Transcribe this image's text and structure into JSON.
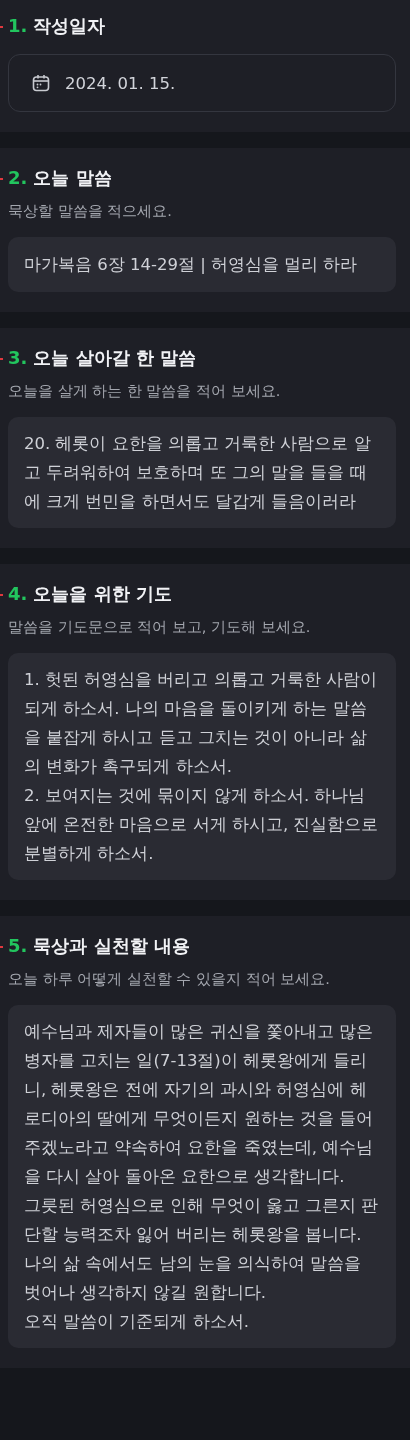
{
  "sections": [
    {
      "kind": "date",
      "required": true,
      "number": "1.",
      "title": "작성일자",
      "value": "2024. 01. 15."
    },
    {
      "kind": "text",
      "required": true,
      "number": "2.",
      "title": "오늘 말씀",
      "description": "묵상할 말씀을 적으세요.",
      "value": "마가복음 6장 14-29절  |  허영심을 멀리 하라"
    },
    {
      "kind": "text",
      "required": true,
      "number": "3.",
      "title": "오늘 살아갈 한 말씀",
      "description": "오늘을 살게 하는 한 말씀을 적어 보세요.",
      "value": "20. 헤롯이 요한을 의롭고 거룩한 사람으로 알고 두려워하여 보호하며 또 그의 말을 들을 때에 크게 번민을 하면서도 달갑게 들음이러라"
    },
    {
      "kind": "text",
      "required": true,
      "number": "4.",
      "title": "오늘을 위한 기도",
      "description": "말씀을 기도문으로 적어 보고, 기도해 보세요.",
      "value": "1. 헛된 허영심을 버리고 의롭고 거룩한 사람이 되게 하소서. 나의 마음을 돌이키게 하는 말씀을 붙잡게 하시고 듣고 그치는 것이 아니라 삶의 변화가 촉구되게 하소서.\n2. 보여지는 것에 묶이지 않게 하소서. 하나님 앞에 온전한 마음으로 서게 하시고, 진실함으로 분별하게 하소서."
    },
    {
      "kind": "text",
      "required": true,
      "number": "5.",
      "title": "묵상과 실천할 내용",
      "description": "오늘 하루 어떻게 실천할 수 있을지 적어 보세요.",
      "value": "예수님과 제자들이 많은 귀신을 쫓아내고 많은 병자를 고치는 일(7-13절)이 헤롯왕에게 들리니, 헤롯왕은 전에 자기의 과시와 허영심에 헤로디아의 딸에게 무엇이든지 원하는 것을 들어 주겠노라고 약속하여 요한을 죽였는데, 예수님을 다시 살아 돌아온 요한으로 생각합니다.\n그릇된 허영심으로 인해 무엇이 옳고 그른지 판단할 능력조차 잃어 버리는 헤롯왕을 봅니다.\n나의 삶 속에서도 남의 눈을 의식하여 말씀을 벗어나 생각하지 않길 원합니다.\n오직 말씀이 기준되게 하소서."
    }
  ]
}
